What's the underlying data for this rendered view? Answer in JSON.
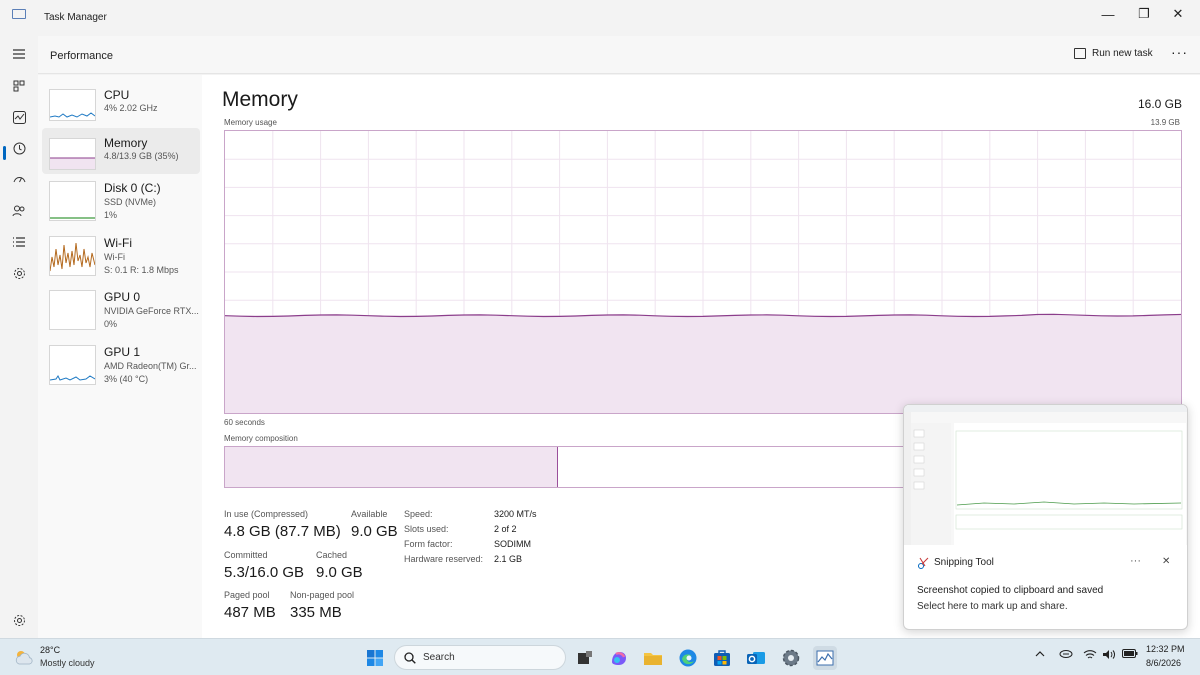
{
  "window": {
    "title": "Task Manager",
    "controls": [
      "—",
      "❐",
      "✕"
    ]
  },
  "header": {
    "section_title": "Performance",
    "run_new_task": "Run new task",
    "more": "···"
  },
  "nav": {
    "items": [
      "menu-icon",
      "processes-icon",
      "performance-icon",
      "app-history-icon",
      "startup-apps-icon",
      "users-icon",
      "details-icon",
      "services-icon",
      "settings-icon"
    ],
    "selected": "performance-icon"
  },
  "sidebar": {
    "items": [
      {
        "name": "CPU",
        "sub1": "4% 2.02 GHz",
        "sub2": ""
      },
      {
        "name": "Memory",
        "sub1": "4.8/13.9 GB (35%)",
        "sub2": ""
      },
      {
        "name": "Disk 0 (C:)",
        "sub1": "SSD (NVMe)",
        "sub2": "1%"
      },
      {
        "name": "Wi-Fi",
        "sub1": "Wi-Fi",
        "sub2": "S: 0.1 R: 1.8 Mbps"
      },
      {
        "name": "GPU 0",
        "sub1": "NVIDIA GeForce RTX...",
        "sub2": "0%"
      },
      {
        "name": "GPU 1",
        "sub1": "AMD Radeon(TM) Gr...",
        "sub2": "3% (40 °C)"
      }
    ],
    "selected_index": 1
  },
  "memory": {
    "title": "Memory",
    "total": "16.0 GB",
    "usage_label": "Memory usage",
    "usage_max": "13.9 GB",
    "time_label": "60 seconds",
    "composition_label": "Memory composition",
    "in_use_fraction": 0.348,
    "usage_level_fraction": 0.345,
    "stats": {
      "in_use_label": "In use (Compressed)",
      "in_use_value": "4.8 GB (87.7 MB)",
      "available_label": "Available",
      "available_value": "9.0 GB",
      "committed_label": "Committed",
      "committed_value": "5.3/16.0 GB",
      "cached_label": "Cached",
      "cached_value": "9.0 GB",
      "paged_label": "Paged pool",
      "paged_value": "487 MB",
      "nonpaged_label": "Non-paged pool",
      "nonpaged_value": "335 MB"
    },
    "details": [
      {
        "label": "Speed:",
        "value": "3200 MT/s"
      },
      {
        "label": "Slots used:",
        "value": "2 of 2"
      },
      {
        "label": "Form factor:",
        "value": "SODIMM"
      },
      {
        "label": "Hardware reserved:",
        "value": "2.1 GB"
      }
    ]
  },
  "notification": {
    "app": "Snipping Tool",
    "more": "···",
    "close": "✕",
    "line1": "Screenshot copied to clipboard and saved",
    "line2": "Select here to mark up and share."
  },
  "taskbar": {
    "weather_temp": "28°C",
    "weather_desc": "Mostly cloudy",
    "search": "Search",
    "apps": [
      "windows-start-icon",
      "task-view-icon",
      "copilot-icon",
      "file-explorer-icon",
      "edge-icon",
      "microsoft-store-icon",
      "outlook-icon",
      "settings-icon",
      "task-manager-icon"
    ],
    "time": "12:32 PM",
    "date": "8/6/2026"
  },
  "colors": {
    "memory_line": "#8b3d8b",
    "memory_fill": "#f1e4f1",
    "memory_border": "#c9a5c9",
    "accent": "#0067c0"
  }
}
